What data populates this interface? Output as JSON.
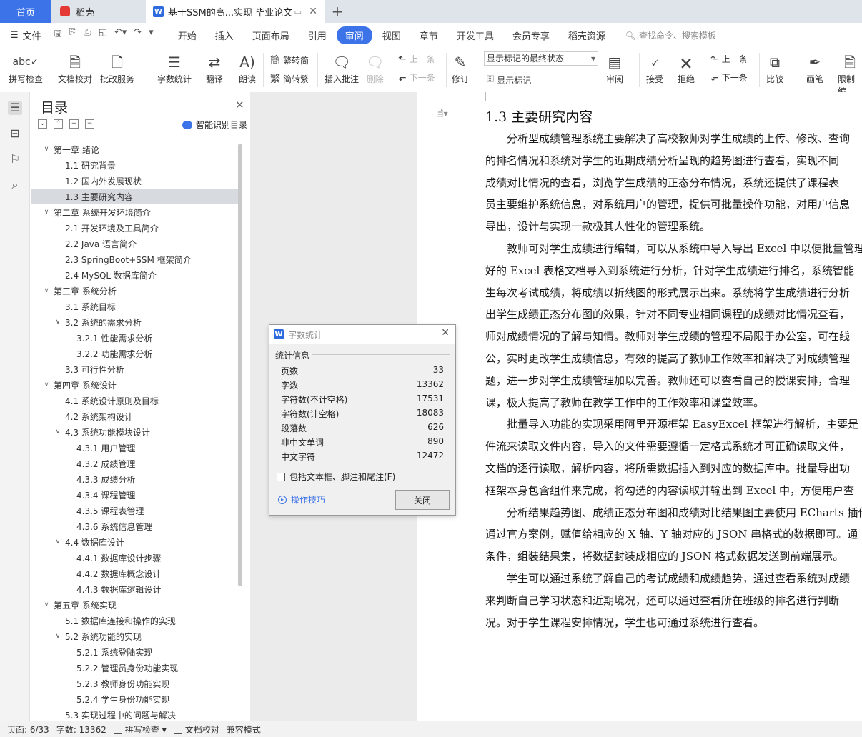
{
  "tabs": {
    "home": "首页",
    "daoke": "稻壳",
    "doc": "基于SSM的高...实现 毕业论文"
  },
  "menubar": {
    "file": "文件",
    "items": [
      "开始",
      "插入",
      "页面布局",
      "引用",
      "审阅",
      "视图",
      "章节",
      "开发工具",
      "会员专享",
      "稻壳资源"
    ],
    "active": "审阅",
    "search": "查找命令、搜索模板"
  },
  "ribbon": {
    "spell_check": "拼写检查",
    "doc_check": "文档校对",
    "batch_service": "批改服务",
    "word_count": "字数统计",
    "translate": "翻译",
    "read_aloud": "朗读",
    "to_traditional": "繁转简",
    "to_simplified": "简转繁",
    "insert_comment": "插入批注",
    "delete": "删除",
    "prev_comment": "上一条",
    "next_comment": "下一条",
    "track_changes": "修订",
    "markup_state": "显示标记的最终状态",
    "show_markup": "显示标记",
    "review": "审阅",
    "accept": "接受",
    "reject": "拒绝",
    "prev_change": "上一条",
    "next_change": "下一条",
    "compare": "比较",
    "pen": "画笔",
    "restrict": "限制编"
  },
  "toc": {
    "title": "目录",
    "smart": "智能识别目录",
    "items": [
      {
        "text": "第一章  绪论",
        "level": 0,
        "arrow": true
      },
      {
        "text": "1.1  研究背景",
        "level": 1
      },
      {
        "text": "1.2  国内外发展现状",
        "level": 1
      },
      {
        "text": "1.3  主要研究内容",
        "level": 1,
        "selected": true
      },
      {
        "text": "第二章  系统开发环境简介",
        "level": 0,
        "arrow": true
      },
      {
        "text": "2.1  开发环境及工具简介",
        "level": 1
      },
      {
        "text": "2.2 Java 语言简介",
        "level": 1
      },
      {
        "text": "2.3 SpringBoot+SSM 框架简介",
        "level": 1
      },
      {
        "text": "2.4 MySQL 数据库简介",
        "level": 1
      },
      {
        "text": "第三章  系统分析",
        "level": 0,
        "arrow": true
      },
      {
        "text": "3.1  系统目标",
        "level": 1
      },
      {
        "text": "3.2  系统的需求分析",
        "level": 1,
        "arrow": true
      },
      {
        "text": "3.2.1  性能需求分析",
        "level": 2
      },
      {
        "text": "3.2.2  功能需求分析",
        "level": 2
      },
      {
        "text": "3.3  可行性分析",
        "level": 1
      },
      {
        "text": "第四章  系统设计",
        "level": 0,
        "arrow": true
      },
      {
        "text": "4.1  系统设计原则及目标",
        "level": 1
      },
      {
        "text": "4.2  系统架构设计",
        "level": 1
      },
      {
        "text": "4.3  系统功能模块设计",
        "level": 1,
        "arrow": true
      },
      {
        "text": "4.3.1  用户管理",
        "level": 2
      },
      {
        "text": "4.3.2  成绩管理",
        "level": 2
      },
      {
        "text": "4.3.3  成绩分析",
        "level": 2
      },
      {
        "text": "4.3.4  课程管理",
        "level": 2
      },
      {
        "text": "4.3.5  课程表管理",
        "level": 2
      },
      {
        "text": "4.3.6  系统信息管理",
        "level": 2
      },
      {
        "text": "4.4  数据库设计",
        "level": 1,
        "arrow": true
      },
      {
        "text": "4.4.1  数据库设计步骤",
        "level": 2
      },
      {
        "text": "4.4.2  数据库概念设计",
        "level": 2
      },
      {
        "text": "4.4.3  数据库逻辑设计",
        "level": 2
      },
      {
        "text": "第五章  系统实现",
        "level": 0,
        "arrow": true
      },
      {
        "text": "5.1  数据库连接和操作的实现",
        "level": 1
      },
      {
        "text": "5.2  系统功能的实现",
        "level": 1,
        "arrow": true
      },
      {
        "text": "5.2.1  系统登陆实现",
        "level": 2
      },
      {
        "text": "5.2.2  管理员身份功能实现",
        "level": 2
      },
      {
        "text": "5.2.3  教师身份功能实现",
        "level": 2
      },
      {
        "text": "5.2.4  学生身份功能实现",
        "level": 2
      },
      {
        "text": "5.3  实现过程中的问题与解决",
        "level": 1
      }
    ]
  },
  "document": {
    "heading": "1.3  主要研究内容",
    "lines": [
      "　　分析型成绩管理系统主要解决了高校教师对学生成绩的上传、修改、查询",
      "的排名情况和系统对学生的近期成绩分析呈现的趋势图进行查看，实现不同",
      "成绩对比情况的查看，浏览学生成绩的正态分布情况，系统还提供了课程表",
      "员主要维护系统信息，对系统用户的管理，提供可批量操作功能，对用户信息",
      "导出，设计与实现一款极其人性化的管理系统。",
      "　　教师可对学生成绩进行编辑，可以从系统中导入导出 Excel 中以便批量管理",
      "好的 Excel 表格文档导入到系统进行分析，针对学生成绩进行排名，系统智能",
      "生每次考试成绩，将成绩以折线图的形式展示出来。系统将学生成绩进行分析",
      "出学生成绩正态分布图的效果，针对不同专业相同课程的成绩对比情况查看，",
      "师对成绩情况的了解与知情。教师对学生成绩的管理不局限于办公室，可在线",
      "公，实时更改学生成绩信息，有效的提高了教师工作效率和解决了对成绩管理",
      "题，进一步对学生成绩管理加以完善。教师还可以查看自己的授课安排，合理",
      "课，极大提高了教师在教学工作中的工作效率和课堂效率。",
      "　　批量导入功能的实现采用阿里开源框架 EasyExcel 框架进行解析，主要是",
      "件流来读取文件内容，导入的文件需要遵循一定格式系统才可正确读取文件，",
      "文档的逐行读取，解析内容，将所需数据插入到对应的数据库中。批量导出功",
      "框架本身包含组件来完成，将勾选的内容读取并输出到 Excel 中，方便用户查",
      "　　分析结果趋势图、成绩正态分布图和成绩对比结果图主要使用 ECharts 插件",
      "通过官方案例，赋值给相应的 X 轴、Y 轴对应的 JSON 串格式的数据即可。通",
      "条件，组装结果集，将数据封装成相应的 JSON 格式数据发送到前端展示。",
      "　　学生可以通过系统了解自己的考试成绩和成绩趋势，通过查看系统对成绩",
      "来判断自己学习状态和近期境况，还可以通过查看所在班级的排名进行判断",
      "况。对于学生课程安排情况，学生也可通过系统进行查看。"
    ]
  },
  "dialog": {
    "title": "字数统计",
    "section": "统计信息",
    "stats": [
      {
        "label": "页数",
        "value": "33"
      },
      {
        "label": "字数",
        "value": "13362"
      },
      {
        "label": "字符数(不计空格)",
        "value": "17531"
      },
      {
        "label": "字符数(计空格)",
        "value": "18083"
      },
      {
        "label": "段落数",
        "value": "626"
      },
      {
        "label": "非中文单词",
        "value": "890"
      },
      {
        "label": "中文字符",
        "value": "12472"
      }
    ],
    "checkbox": "包括文本框、脚注和尾注(F)",
    "tips": "操作技巧",
    "close": "关闭"
  },
  "status": {
    "page": "页面: 6/33",
    "words": "字数: 13362",
    "spell": "拼写检查",
    "proof": "文档校对",
    "compat": "兼容模式"
  },
  "colors": {
    "accent": "#3c73e8",
    "selected_toc": "#d7dbe0"
  }
}
